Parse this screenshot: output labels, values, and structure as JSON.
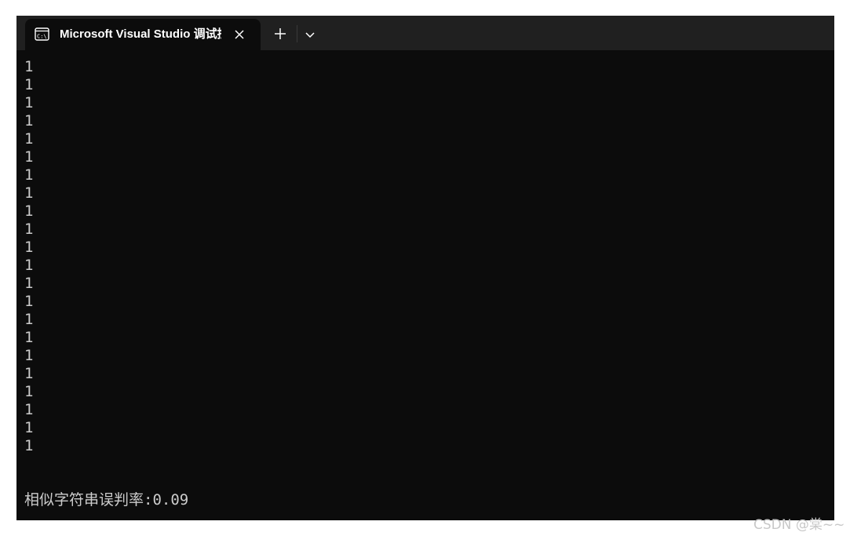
{
  "tab": {
    "title": "Microsoft Visual Studio 调试控",
    "icon": "console-icon"
  },
  "console": {
    "lines": [
      "1",
      "1",
      "1",
      "1",
      "1",
      "1",
      "1",
      "1",
      "1",
      "1",
      "1",
      "1",
      "1",
      "1",
      "1",
      "1",
      "1",
      "1",
      "1",
      "1",
      "1",
      "1"
    ],
    "result_line": "相似字符串误判率:0.09"
  },
  "watermark": "CSDN @棠~~",
  "colors": {
    "console_bg": "#0c0c0c",
    "titlebar_bg": "#202020",
    "console_text": "#cccccc"
  }
}
